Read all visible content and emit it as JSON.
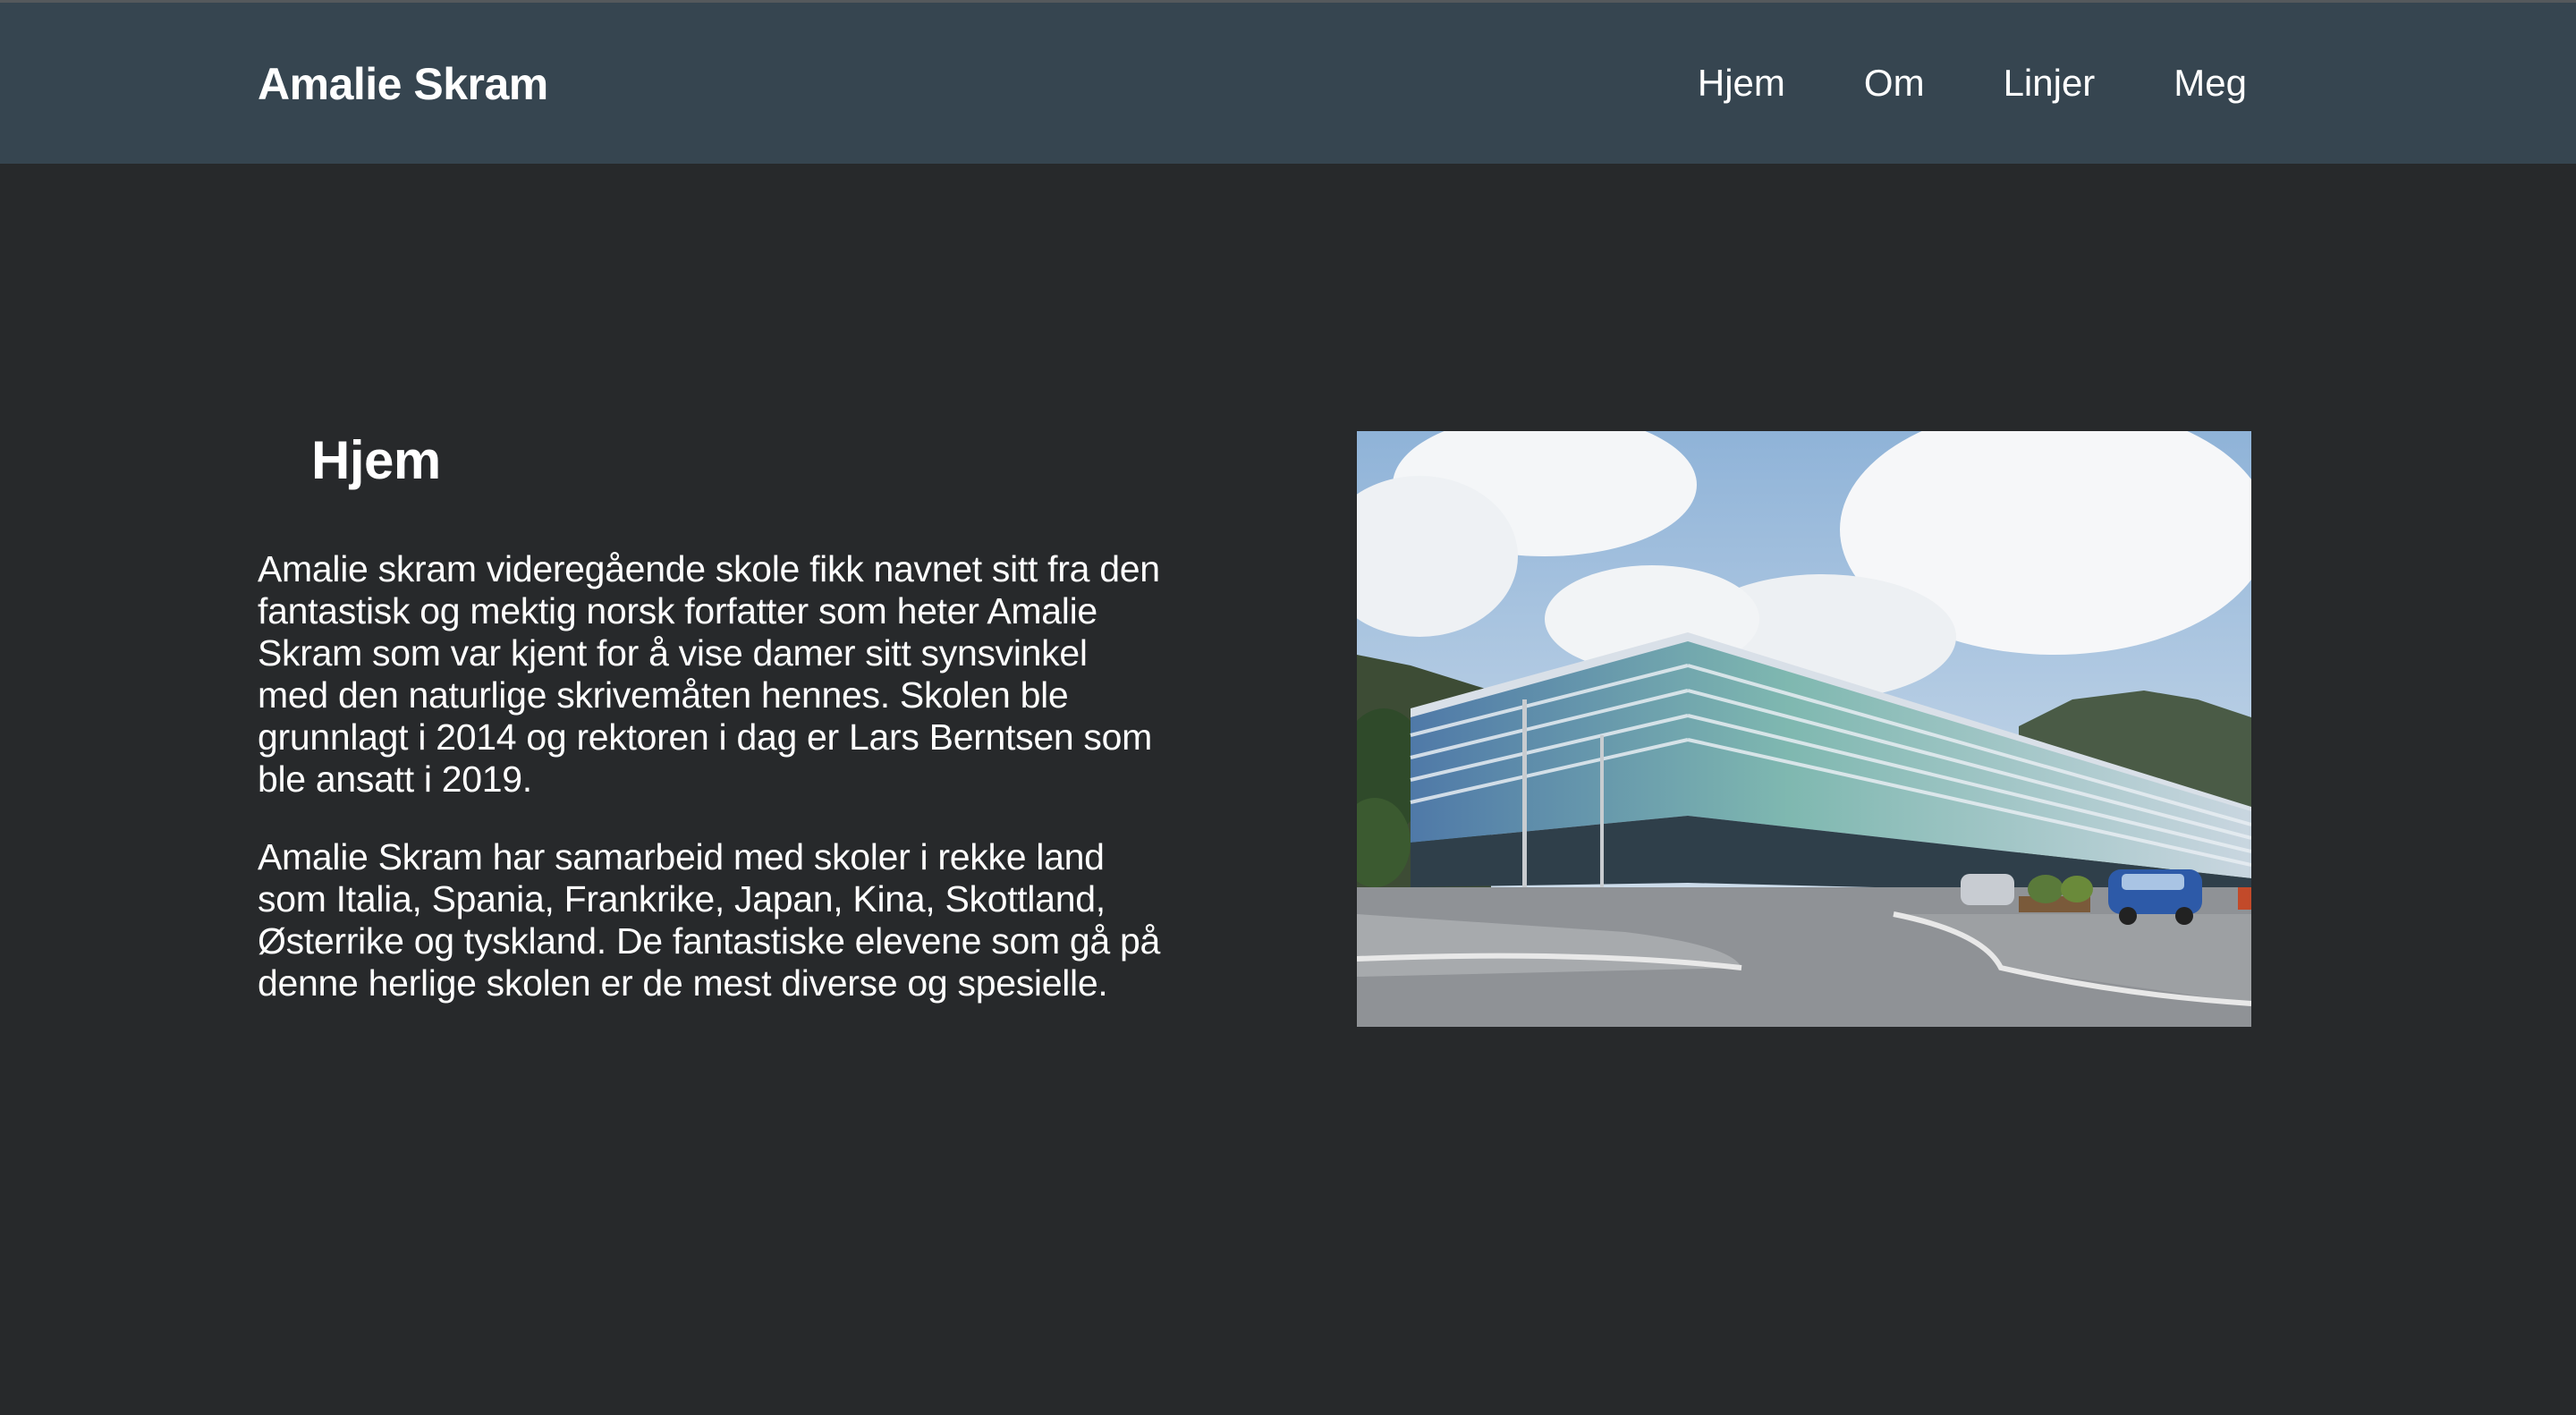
{
  "header": {
    "brand": "Amalie Skram",
    "nav": [
      "Hjem",
      "Om",
      "Linjer",
      "Meg"
    ]
  },
  "main": {
    "title": "Hjem",
    "paragraphs": [
      "Amalie skram videregående skole fikk navnet sitt fra den fantastisk og mektig norsk forfatter som heter Amalie Skram som var kjent for å vise damer sitt synsvinkel med den naturlige skrivemåten hennes. Skolen ble grunnlagt i 2014 og rektoren i dag er Lars Berntsen som ble ansatt i 2019.",
      "Amalie Skram har samarbeid med skoler i rekke land som Italia, Spania, Frankrike, Japan, Kina, Skottland, Østerrike og tyskland. De fantastiske elevene som gå på denne herlige skolen er de mest diverse og spesielle."
    ],
    "image": {
      "subject": "school-building-photo"
    }
  },
  "colors": {
    "page_background": "#27292b",
    "navbar_background": "#364550",
    "text": "#ffffff"
  }
}
